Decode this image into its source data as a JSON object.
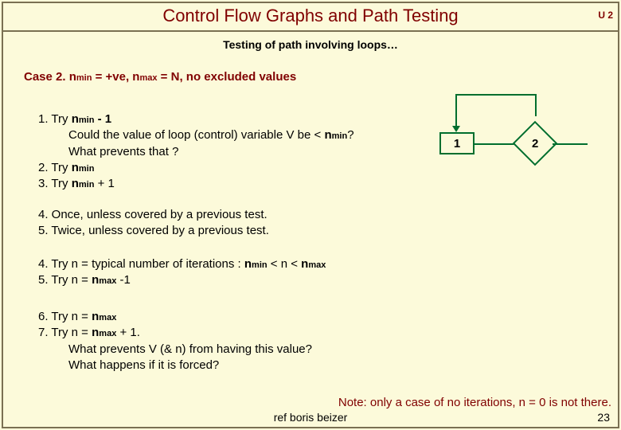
{
  "title": "Control Flow Graphs and Path Testing",
  "unit": "U 2",
  "subtitle": "Testing of path involving loops…",
  "case": {
    "prefix": "Case 2",
    "text1": ". n",
    "sub1": "min",
    "text2": " = +ve,  n",
    "sub2": "max",
    "text3": " = N,   no excluded values"
  },
  "b1": {
    "l1a": "1. Try ",
    "l1b": "n",
    "l1s": "min",
    "l1c": " - 1",
    "l2a": "Could the value of loop (control) variable V be < ",
    "l2b": "n",
    "l2s": "min",
    "l2c": "?",
    "l3": "What prevents that ?",
    "l4a": "2. Try ",
    "l4b": "n",
    "l4s": "min",
    "l5a": "3. Try ",
    "l5b": "n",
    "l5s": "min",
    "l5c": " + 1"
  },
  "b2": {
    "l1": "4. Once, unless covered by a previous test.",
    "l2": "5. Twice, unless covered by a previous test."
  },
  "b3": {
    "l1a": "4. Try n = typical number of iterations : ",
    "l1b": "n",
    "l1s": "min",
    "l1c": " < n < ",
    "l1d": "n",
    "l1s2": "max",
    "l2a": "5. Try n = ",
    "l2b": "n",
    "l2s": "max",
    "l2c": " -1"
  },
  "b4": {
    "l1a": "6. Try n = ",
    "l1b": "n",
    "l1s": "max",
    "l2a": "7. Try n = ",
    "l2b": "n",
    "l2s": "max",
    "l2c": " + 1.",
    "l3": "What prevents V (& n) from having this value?",
    "l4": "What happens if it is forced?"
  },
  "note": "Note: only a case of no iterations, n = 0 is not there.",
  "ref": "ref boris beizer",
  "pagenum": "23",
  "nodes": {
    "n1": "1",
    "n2": "2"
  }
}
